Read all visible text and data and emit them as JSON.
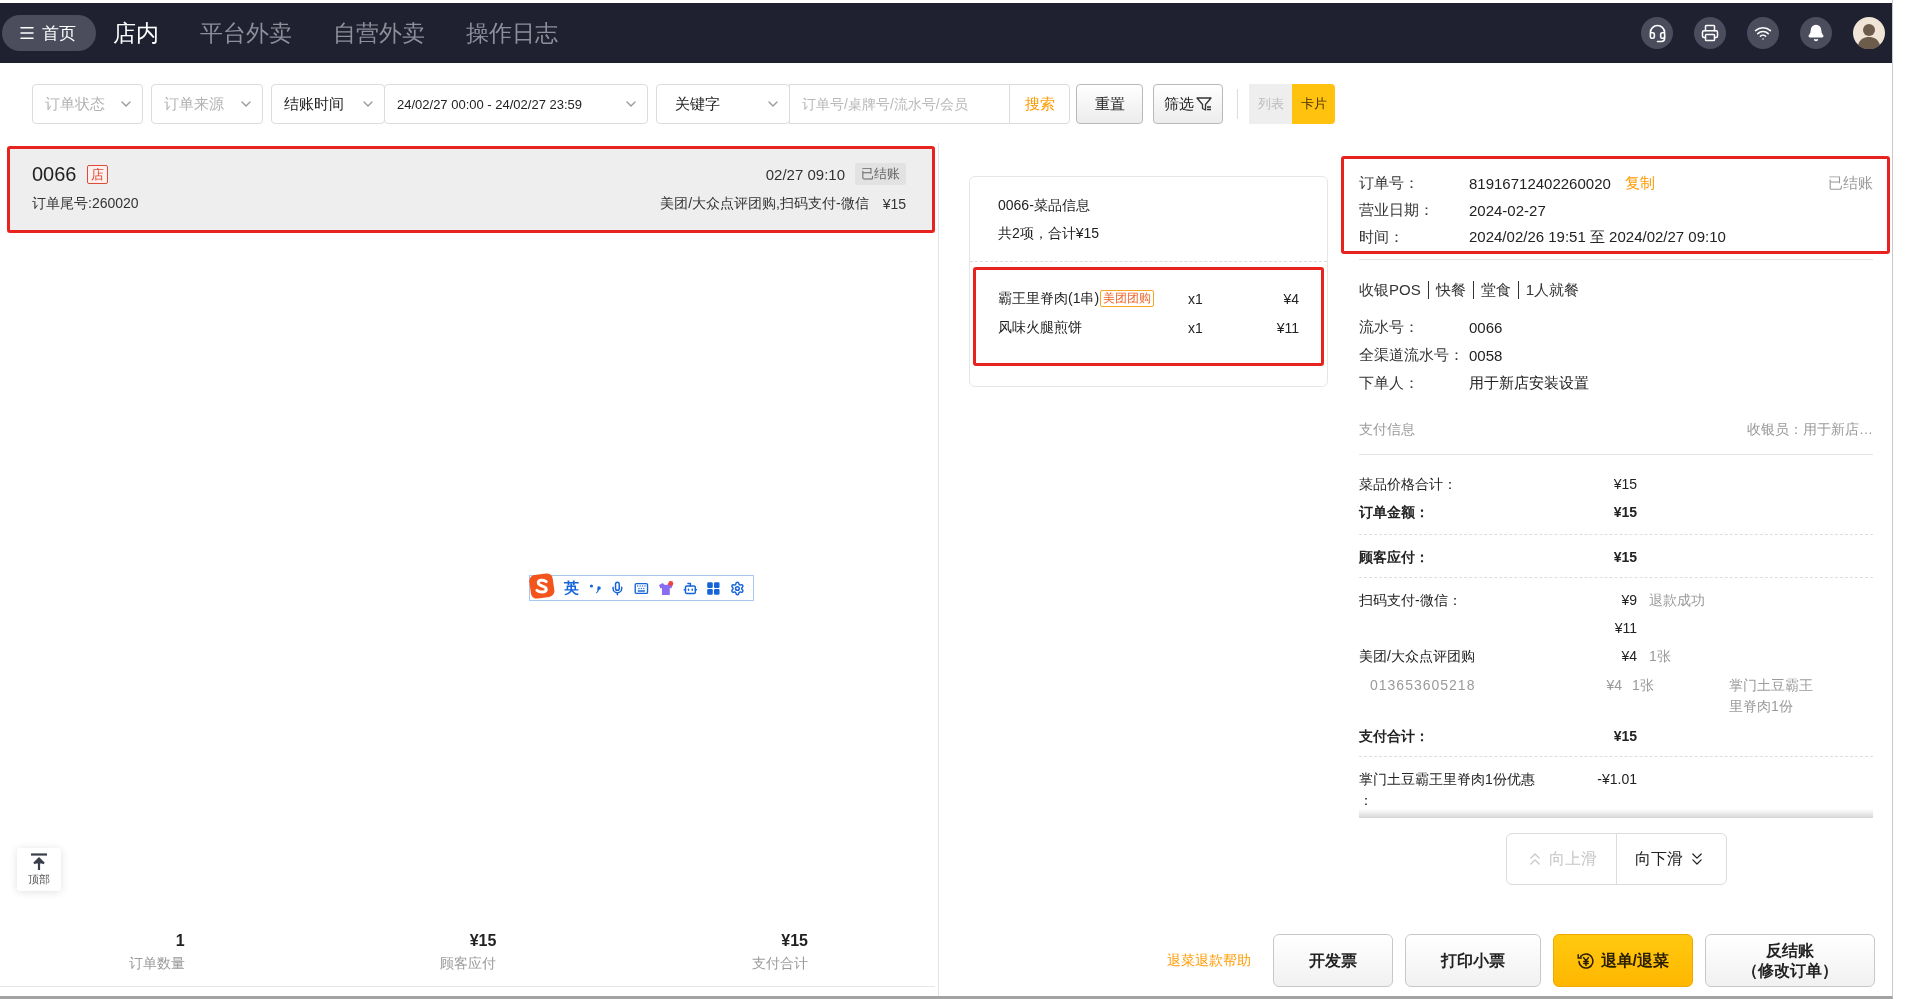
{
  "top_bar": {
    "home_button": "首页",
    "tabs": [
      {
        "label": "店内",
        "selected": true
      },
      {
        "label": "平台外卖",
        "selected": false
      },
      {
        "label": "自营外卖",
        "selected": false
      },
      {
        "label": "操作日志",
        "selected": false
      }
    ]
  },
  "filters": {
    "order_status": {
      "placeholder": "订单状态"
    },
    "order_source": {
      "placeholder": "订单来源"
    },
    "time_type": {
      "value": "结账时间"
    },
    "date_range": {
      "value": "24/02/27 00:00 - 24/02/27 23:59"
    },
    "keyword_type": {
      "value": "关键字"
    },
    "keyword": {
      "placeholder": "订单号/桌牌号/流水号/会员"
    },
    "search_button": "搜索",
    "reset_button": "重置",
    "filter_button": "筛选",
    "view_modes": [
      {
        "label": "列表",
        "selected": false
      },
      {
        "label": "卡片",
        "selected": true
      }
    ]
  },
  "orders": [
    {
      "serial": "0066",
      "source_badge": "店",
      "time": "02/27 09:10",
      "status": "已结账",
      "tail_number": "订单尾号:260020",
      "payments": "美团/大众点评团购,扫码支付-微信",
      "amount": "¥15",
      "selected": true,
      "highlighted": true
    }
  ],
  "back_to_top": "顶部",
  "summary": [
    {
      "value": "1",
      "label": "订单数量"
    },
    {
      "value": "¥15",
      "label": "顾客应付"
    },
    {
      "value": "¥15",
      "label": "支付合计"
    }
  ],
  "ime_toolbar": {
    "mode": "英"
  },
  "dishes": {
    "title": "0066-菜品信息",
    "summary": "共2项，合计¥15",
    "highlighted": true,
    "items": [
      {
        "name": "霸王里脊肉(1串)",
        "tag": "美团团购",
        "quantity": "x1",
        "price": "¥4"
      },
      {
        "name": "风味火腿煎饼",
        "quantity": "x1",
        "price": "¥11"
      }
    ]
  },
  "order_info": {
    "highlighted": true,
    "status": "已结账",
    "rows": [
      {
        "label": "订单号：",
        "value": "81916712402260020",
        "action": "复制"
      },
      {
        "label": "营业日期：",
        "value": "2024-02-27"
      },
      {
        "label": "时间：",
        "value": "2024/02/26 19:51 至 2024/02/27 09:10"
      }
    ]
  },
  "order_tags": [
    "收银POS",
    "快餐",
    "堂食",
    "1人就餐"
  ],
  "details": [
    {
      "label": "流水号：",
      "value": "0066"
    },
    {
      "label": "全渠道流水号：",
      "value": "0058"
    },
    {
      "label": "下单人：",
      "value": "用于新店安装设置"
    }
  ],
  "payment_info": {
    "title": "支付信息",
    "cashier": "收银员：用于新店…"
  },
  "payment_sections": [
    {
      "rows": [
        {
          "kind": "line",
          "label": "菜品价格合计：",
          "amount": "¥15"
        },
        {
          "kind": "total",
          "label": "订单金额：",
          "amount": "¥15"
        }
      ]
    },
    {
      "rows": [
        {
          "kind": "total",
          "label": "顾客应付：",
          "amount": "¥15"
        }
      ]
    },
    {
      "rows": [
        {
          "kind": "line",
          "label": "扫码支付-微信：",
          "amount": "¥9",
          "note": "退款成功"
        },
        {
          "kind": "line",
          "amount": "¥11"
        },
        {
          "kind": "line",
          "label": "美团/大众点评团购",
          "amount": "¥4",
          "note": "1张"
        },
        {
          "kind": "voucher",
          "code": "013653605218",
          "amount": "¥4",
          "note": "1张",
          "detail": "掌门土豆霸王里脊肉1份"
        },
        {
          "kind": "total",
          "label": "支付合计：",
          "amount": "¥15"
        }
      ]
    },
    {
      "rows": [
        {
          "kind": "line",
          "label": "掌门土豆霸王里脊肉1份优惠：",
          "amount": "-¥1.01"
        }
      ]
    }
  ],
  "scroll_buttons": [
    {
      "label": "向上滑",
      "kind": "up",
      "disabled": true
    },
    {
      "label": "向下滑",
      "kind": "down",
      "disabled": false
    }
  ],
  "actions": {
    "help_link": "退菜退款帮助",
    "buttons": [
      {
        "label": "开发票",
        "kind": "default"
      },
      {
        "label": "打印小票",
        "kind": "default"
      },
      {
        "label": "退单/退菜",
        "kind": "primary"
      },
      {
        "label": "反结账（修改订单）",
        "kind": "default"
      }
    ]
  }
}
